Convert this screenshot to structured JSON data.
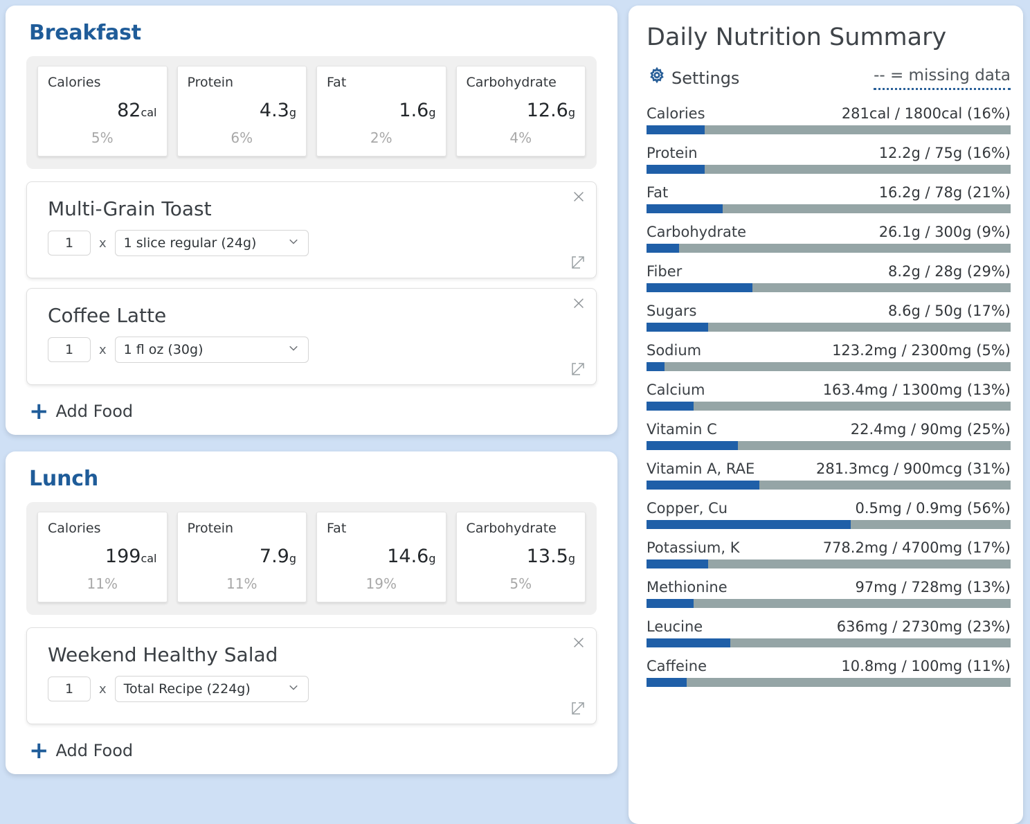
{
  "meals": [
    {
      "title": "Breakfast",
      "macros": [
        {
          "label": "Calories",
          "value": "82",
          "unit": "cal",
          "pct": "5%"
        },
        {
          "label": "Protein",
          "value": "4.3",
          "unit": "g",
          "pct": "6%"
        },
        {
          "label": "Fat",
          "value": "1.6",
          "unit": "g",
          "pct": "2%"
        },
        {
          "label": "Carbohydrate",
          "value": "12.6",
          "unit": "g",
          "pct": "4%"
        }
      ],
      "foods": [
        {
          "name": "Multi-Grain Toast",
          "qty": "1",
          "times": "x",
          "serving": "1 slice regular (24g)"
        },
        {
          "name": "Coffee Latte",
          "qty": "1",
          "times": "x",
          "serving": "1 fl oz (30g)"
        }
      ],
      "add_label": "Add Food"
    },
    {
      "title": "Lunch",
      "macros": [
        {
          "label": "Calories",
          "value": "199",
          "unit": "cal",
          "pct": "11%"
        },
        {
          "label": "Protein",
          "value": "7.9",
          "unit": "g",
          "pct": "11%"
        },
        {
          "label": "Fat",
          "value": "14.6",
          "unit": "g",
          "pct": "19%"
        },
        {
          "label": "Carbohydrate",
          "value": "13.5",
          "unit": "g",
          "pct": "5%"
        }
      ],
      "foods": [
        {
          "name": "Weekend Healthy Salad",
          "qty": "1",
          "times": "x",
          "serving": "Total Recipe (224g)"
        }
      ],
      "add_label": "Add Food"
    }
  ],
  "summary": {
    "title": "Daily Nutrition Summary",
    "settings_label": "Settings",
    "missing_note": "-- = missing data",
    "colors": {
      "bar_fill": "#1f5fa8",
      "bar_track": "#95a5a6",
      "accent": "#1f5c99"
    },
    "nutrients": [
      {
        "name": "Calories",
        "text": "281cal / 1800cal (16%)",
        "pct": 16
      },
      {
        "name": "Protein",
        "text": "12.2g / 75g (16%)",
        "pct": 16
      },
      {
        "name": "Fat",
        "text": "16.2g / 78g (21%)",
        "pct": 21
      },
      {
        "name": "Carbohydrate",
        "text": "26.1g / 300g (9%)",
        "pct": 9
      },
      {
        "name": "Fiber",
        "text": "8.2g / 28g (29%)",
        "pct": 29
      },
      {
        "name": "Sugars",
        "text": "8.6g / 50g (17%)",
        "pct": 17
      },
      {
        "name": "Sodium",
        "text": "123.2mg / 2300mg (5%)",
        "pct": 5
      },
      {
        "name": "Calcium",
        "text": "163.4mg / 1300mg (13%)",
        "pct": 13
      },
      {
        "name": "Vitamin C",
        "text": "22.4mg / 90mg (25%)",
        "pct": 25
      },
      {
        "name": "Vitamin A, RAE",
        "text": "281.3mcg / 900mcg (31%)",
        "pct": 31
      },
      {
        "name": "Copper, Cu",
        "text": "0.5mg / 0.9mg (56%)",
        "pct": 56
      },
      {
        "name": "Potassium, K",
        "text": "778.2mg / 4700mg (17%)",
        "pct": 17
      },
      {
        "name": "Methionine",
        "text": "97mg / 728mg (13%)",
        "pct": 13
      },
      {
        "name": "Leucine",
        "text": "636mg / 2730mg (23%)",
        "pct": 23
      },
      {
        "name": "Caffeine",
        "text": "10.8mg / 100mg (11%)",
        "pct": 11
      }
    ]
  }
}
